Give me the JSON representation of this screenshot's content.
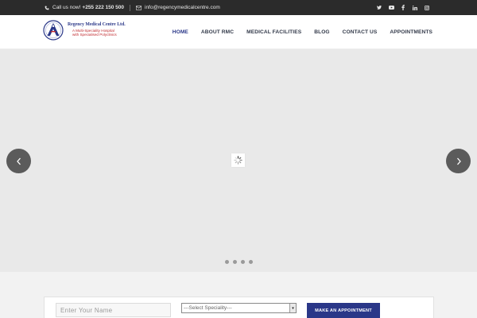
{
  "topbar": {
    "phone_label": "Call us now!",
    "phone_number": "+255 222 150 500",
    "email": "info@regencymedicalcentre.com",
    "social_icons": [
      "twitter-icon",
      "youtube-icon",
      "facebook-icon",
      "linkedin-icon",
      "instagram-icon"
    ]
  },
  "logo": {
    "name": "Regency Medical Centre Ltd.",
    "tagline_1": "A Multi-Speciality Hospital",
    "tagline_2": "with Specialised Polyclinics"
  },
  "nav": {
    "items": [
      {
        "label": "HOME",
        "active": true
      },
      {
        "label": "ABOUT RMC",
        "active": false
      },
      {
        "label": "MEDICAL FACILITIES",
        "active": false
      },
      {
        "label": "BLOG",
        "active": false
      },
      {
        "label": "CONTACT US",
        "active": false
      },
      {
        "label": "APPOINTMENTS",
        "active": false
      }
    ]
  },
  "slider": {
    "prev_icon": "chevron-left-icon",
    "next_icon": "chevron-right-icon",
    "loading_icon": "spinner-icon",
    "slide_count": 4
  },
  "appointment_form": {
    "name_placeholder": "Enter Your Name",
    "speciality_selected": "---Select Speciality---",
    "button_label": "MAKE AN APPOINTMENT"
  },
  "colors": {
    "brand": "#2a3788",
    "accent_red": "#c0282d",
    "topbar_bg": "#2b2b2b",
    "slider_bg": "#e9e9e9"
  }
}
